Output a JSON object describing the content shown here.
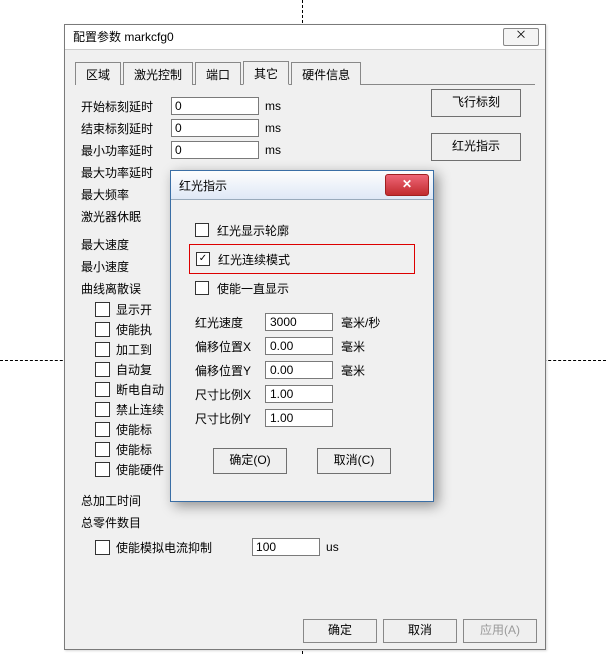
{
  "guides": {},
  "main": {
    "title": "配置参数 markcfg0",
    "close": "⨉",
    "tabs": [
      "区域",
      "激光控制",
      "端口",
      "其它",
      "硬件信息"
    ],
    "active_tab_index": 3,
    "params": [
      {
        "label": "开始标刻延时",
        "value": "0",
        "unit": "ms"
      },
      {
        "label": "结束标刻延时",
        "value": "0",
        "unit": "ms"
      },
      {
        "label": "最小功率延时",
        "value": "0",
        "unit": "ms"
      },
      {
        "label": "最大功率延时",
        "value": "",
        "unit": ""
      },
      {
        "label": "最大频率",
        "value": "",
        "unit": ""
      },
      {
        "label": "激光器休眠",
        "value": "",
        "unit": ""
      }
    ],
    "speed_labels": [
      "最大速度",
      "最小速度",
      "曲线离散误"
    ],
    "side_buttons": {
      "fly": "飞行标刻",
      "light": "红光指示"
    },
    "checks": [
      "显示开",
      "使能执",
      "加工到",
      "自动复",
      "断电自动",
      "禁止连续",
      "使能标",
      "使能标",
      "使能硬件"
    ],
    "totals": [
      "总加工时间",
      "总零件数目"
    ],
    "analog": {
      "check": "使能模拟电流抑制",
      "value": "100",
      "unit": "us"
    },
    "buttons": {
      "ok": "确定",
      "cancel": "取消",
      "apply": "应用(A)"
    }
  },
  "sub": {
    "title": "红光指示",
    "close": "✕",
    "checks": [
      {
        "label": "红光显示轮廓",
        "checked": false
      },
      {
        "label": "红光连续模式",
        "checked": true
      },
      {
        "label": "使能一直显示",
        "checked": false
      }
    ],
    "rows": [
      {
        "label": "红光速度",
        "value": "3000",
        "unit": "毫米/秒"
      },
      {
        "label": "偏移位置X",
        "value": "0.00",
        "unit": "毫米"
      },
      {
        "label": "偏移位置Y",
        "value": "0.00",
        "unit": "毫米"
      },
      {
        "label": "尺寸比例X",
        "value": "1.00",
        "unit": ""
      },
      {
        "label": "尺寸比例Y",
        "value": "1.00",
        "unit": ""
      }
    ],
    "buttons": {
      "ok": "确定(O)",
      "cancel": "取消(C)"
    }
  }
}
